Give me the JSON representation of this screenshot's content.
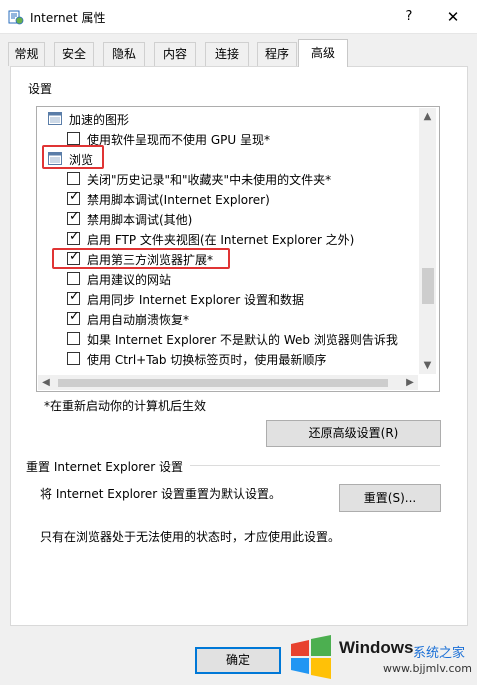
{
  "window": {
    "title": "Internet 属性",
    "help_label": "?",
    "close_label": "✕"
  },
  "tabs": [
    {
      "label": "常规"
    },
    {
      "label": "安全"
    },
    {
      "label": "隐私"
    },
    {
      "label": "内容"
    },
    {
      "label": "连接"
    },
    {
      "label": "程序"
    },
    {
      "label": "高级",
      "active": true
    }
  ],
  "settings": {
    "header": "设置",
    "items": [
      {
        "type": "group",
        "icon": "graphics-folder-icon",
        "label": "加速的图形"
      },
      {
        "type": "check",
        "checked": false,
        "label": "使用软件呈现而不使用 GPU 呈现*"
      },
      {
        "type": "group",
        "icon": "browse-folder-icon",
        "label": "浏览"
      },
      {
        "type": "check",
        "checked": false,
        "label": "关闭\"历史记录\"和\"收藏夹\"中未使用的文件夹*"
      },
      {
        "type": "check",
        "checked": true,
        "label": "禁用脚本调试(Internet Explorer)"
      },
      {
        "type": "check",
        "checked": true,
        "label": "禁用脚本调试(其他)"
      },
      {
        "type": "check",
        "checked": true,
        "label": "启用 FTP 文件夹视图(在 Internet Explorer 之外)"
      },
      {
        "type": "check",
        "checked": true,
        "label": "启用第三方浏览器扩展*"
      },
      {
        "type": "check",
        "checked": false,
        "label": "启用建议的网站"
      },
      {
        "type": "check",
        "checked": true,
        "label": "启用同步 Internet Explorer 设置和数据"
      },
      {
        "type": "check",
        "checked": true,
        "label": "启用自动崩溃恢复*"
      },
      {
        "type": "check",
        "checked": false,
        "label": "如果 Internet Explorer 不是默认的 Web 浏览器则告诉我"
      },
      {
        "type": "check",
        "checked": false,
        "label": "使用 Ctrl+Tab 切换标签页时，使用最新顺序"
      }
    ],
    "restart_note": "*在重新启动你的计算机后生效",
    "restore_button": "还原高级设置(R)"
  },
  "reset": {
    "header": "重置 Internet Explorer 设置",
    "description": "将 Internet Explorer 设置重置为默认设置。",
    "button": "重置(S)...",
    "note": "只有在浏览器处于无法使用的状态时，才应使用此设置。"
  },
  "footer": {
    "ok_button": "确定"
  },
  "watermark": {
    "brand": "Windows",
    "cn": "系统之家",
    "url": "www.bjjmlv.com"
  },
  "colors": {
    "highlight": "#e03434",
    "accent": "#0078d7"
  }
}
